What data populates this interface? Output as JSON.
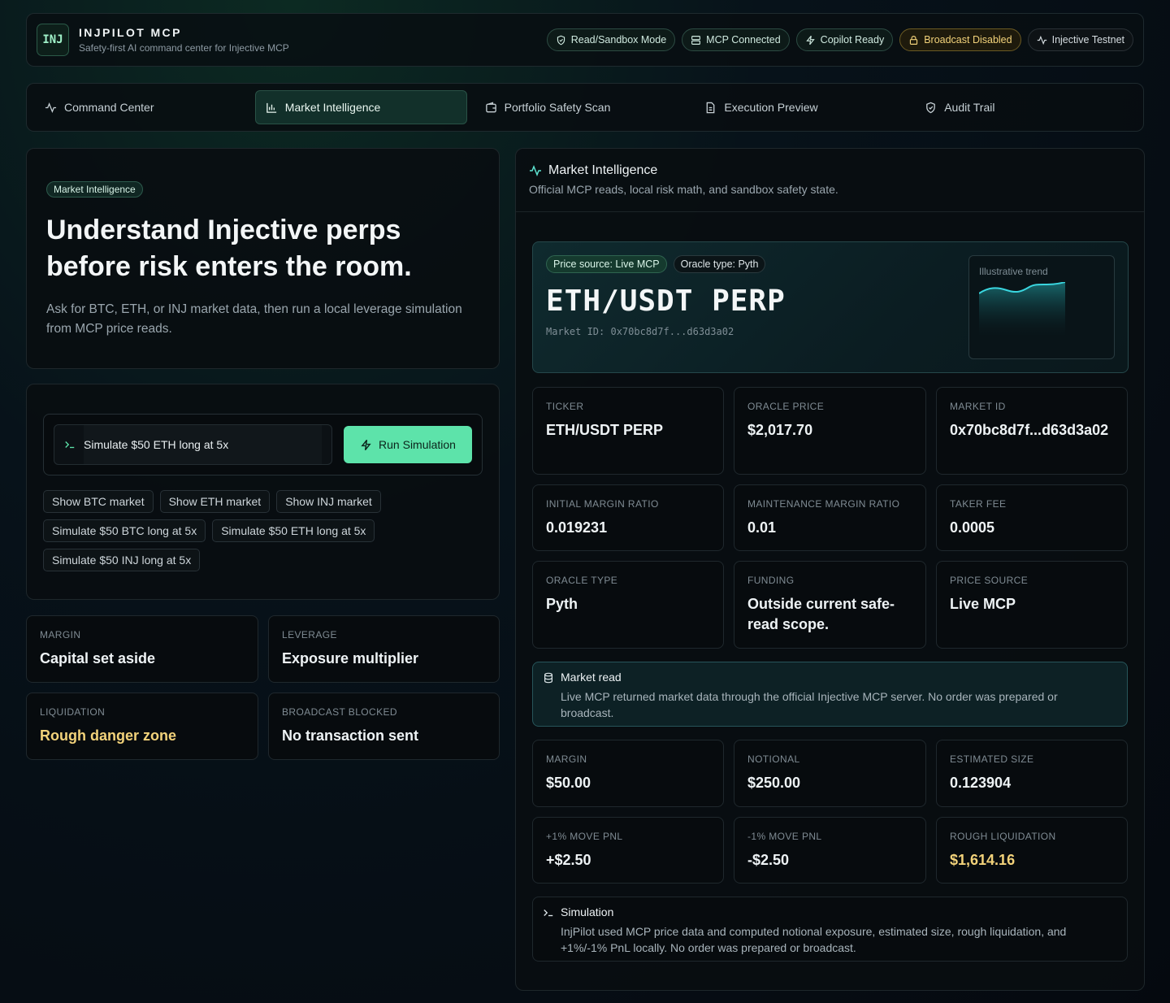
{
  "header": {
    "logo": "INJ",
    "title": "INJPILOT MCP",
    "subtitle": "Safety-first AI command center for Injective MCP",
    "badges": [
      {
        "label": "Read/Sandbox Mode",
        "icon": "shield-icon"
      },
      {
        "label": "MCP Connected",
        "icon": "server-icon"
      },
      {
        "label": "Copilot Ready",
        "icon": "bolt-icon"
      },
      {
        "label": "Broadcast Disabled",
        "icon": "lock-icon"
      },
      {
        "label": "Injective Testnet",
        "icon": "activity-icon"
      }
    ]
  },
  "tabs": [
    {
      "label": "Command Center",
      "icon": "activity-icon"
    },
    {
      "label": "Market Intelligence",
      "icon": "bar-chart-icon",
      "active": true
    },
    {
      "label": "Portfolio Safety Scan",
      "icon": "wallet-icon"
    },
    {
      "label": "Execution Preview",
      "icon": "file-icon"
    },
    {
      "label": "Audit Trail",
      "icon": "shield-check-icon"
    }
  ],
  "hero": {
    "pill": "Market Intelligence",
    "title": "Understand Injective perps before risk enters the room.",
    "body": "Ask for BTC, ETH, or INJ market data, then run a local leverage simulation from MCP price reads."
  },
  "simulation": {
    "input_value": "Simulate $50 ETH long at 5x",
    "run_label": "Run Simulation",
    "chips": [
      "Show BTC market",
      "Show ETH market",
      "Show INJ market",
      "Simulate $50 BTC long at 5x",
      "Simulate $50 ETH long at 5x",
      "Simulate $50 INJ long at 5x"
    ]
  },
  "concepts": [
    {
      "label": "MARGIN",
      "value": "Capital set aside"
    },
    {
      "label": "LEVERAGE",
      "value": "Exposure multiplier"
    },
    {
      "label": "LIQUIDATION",
      "value": "Rough danger zone"
    },
    {
      "label": "BROADCAST BLOCKED",
      "value": "No transaction sent"
    }
  ],
  "right": {
    "title": "Market Intelligence",
    "subtitle": "Official MCP reads, local risk math, and sandbox safety state.",
    "market": {
      "price_source_pill": "Price source: Live MCP",
      "oracle_pill": "Oracle type: Pyth",
      "pair": "ETH/USDT PERP",
      "market_id": "Market ID: 0x70bc8d7f...d63d3a02",
      "trend_label": "Illustrative trend"
    },
    "stats": [
      {
        "label": "TICKER",
        "value": "ETH/USDT PERP"
      },
      {
        "label": "ORACLE PRICE",
        "value": "$2,017.70"
      },
      {
        "label": "MARKET ID",
        "value": "0x70bc8d7f...d63d3a02"
      },
      {
        "label": "INITIAL MARGIN RATIO",
        "value": "0.019231"
      },
      {
        "label": "MAINTENANCE MARGIN RATIO",
        "value": "0.01"
      },
      {
        "label": "TAKER FEE",
        "value": "0.0005"
      },
      {
        "label": "ORACLE TYPE",
        "value": "Pyth"
      },
      {
        "label": "FUNDING",
        "value": "Outside current safe-read scope."
      },
      {
        "label": "PRICE SOURCE",
        "value": "Live MCP"
      }
    ],
    "market_note": {
      "title": "Market read",
      "body": "Live MCP returned market data through the official Injective MCP server. No order was prepared or broadcast."
    },
    "sim_stats": [
      {
        "label": "MARGIN",
        "value": "$50.00"
      },
      {
        "label": "NOTIONAL",
        "value": "$250.00"
      },
      {
        "label": "ESTIMATED SIZE",
        "value": "0.123904"
      },
      {
        "label": "+1% MOVE PNL",
        "value": "+$2.50"
      },
      {
        "label": "-1% MOVE PNL",
        "value": "-$2.50"
      },
      {
        "label": "ROUGH LIQUIDATION",
        "value": "$1,614.16"
      }
    ],
    "sim_note": {
      "title": "Simulation",
      "body": "InjPilot used MCP price data and computed notional exposure, estimated size, rough liquidation, and +1%/-1% PnL locally. No order was prepared or broadcast."
    }
  }
}
